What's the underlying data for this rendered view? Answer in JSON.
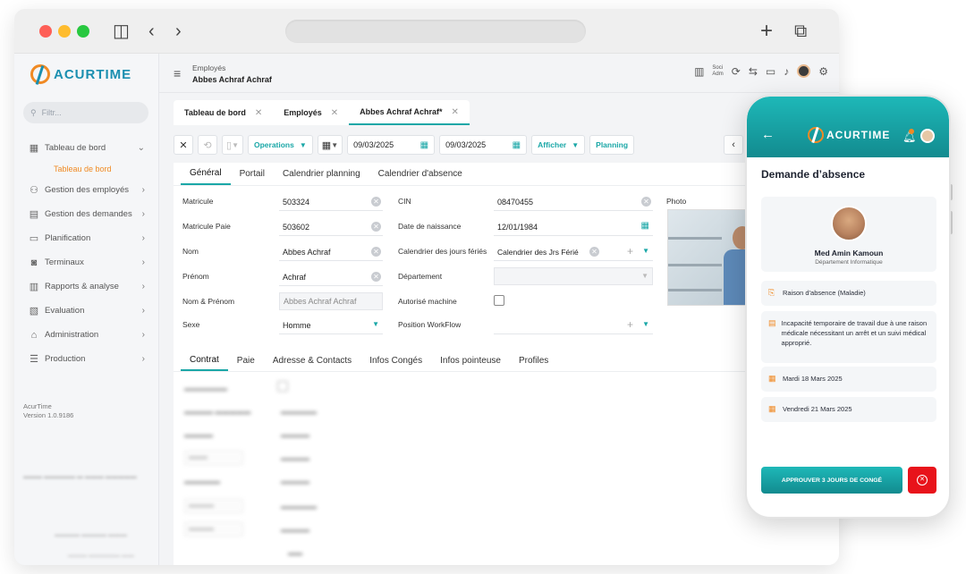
{
  "sidebar": {
    "logo_text": "ACURTIME",
    "filter_placeholder": "Filtr...",
    "items": [
      {
        "icon": "grid-icon",
        "label": "Tableau de bord"
      },
      {
        "icon": "users-icon",
        "label": "Gestion des employés"
      },
      {
        "icon": "doc-icon",
        "label": "Gestion des demandes"
      },
      {
        "icon": "calendar-icon",
        "label": "Planification"
      },
      {
        "icon": "terminal-icon",
        "label": "Terminaux"
      },
      {
        "icon": "chart-icon",
        "label": "Rapports & analyse"
      },
      {
        "icon": "eval-icon",
        "label": "Evaluation"
      },
      {
        "icon": "admin-icon",
        "label": "Administration"
      },
      {
        "icon": "list-icon",
        "label": "Production"
      }
    ],
    "sub_item": "Tableau de bord",
    "version_name": "AcurTime",
    "version_number": "Version 1.0.9186"
  },
  "header": {
    "crumb_parent": "Employés",
    "crumb_current": "Abbes Achraf Achraf",
    "soc_line1": "Soci",
    "soc_line2": "Adm"
  },
  "tabs": [
    {
      "label": "Tableau de bord"
    },
    {
      "label": "Employés"
    },
    {
      "label": "Abbes Achraf Achraf*"
    }
  ],
  "toolbar": {
    "operations": "Operations",
    "date_from": "09/03/2025",
    "date_to": "09/03/2025",
    "afficher": "Afficher",
    "planning": "Planning"
  },
  "subtabs": [
    "Général",
    "Portail",
    "Calendrier planning",
    "Calendrier d'absence"
  ],
  "form": {
    "matricule_label": "Matricule",
    "matricule": "503324",
    "matricule_paie_label": "Matricule Paie",
    "matricule_paie": "503602",
    "nom_label": "Nom",
    "nom": "Abbes Achraf",
    "prenom_label": "Prénom",
    "prenom": "Achraf",
    "nom_prenom_label": "Nom & Prénom",
    "nom_prenom": "Abbes Achraf Achraf",
    "sexe_label": "Sexe",
    "sexe": "Homme",
    "cin_label": "CIN",
    "cin": "08470455",
    "naissance_label": "Date de naissance",
    "naissance": "12/01/1984",
    "calendrier_label": "Calendrier des jours fériés",
    "calendrier": "Calendrier des Jrs Férié",
    "departement_label": "Département",
    "autorise_label": "Autorisé machine",
    "position_label": "Position WorkFlow",
    "photo_label": "Photo"
  },
  "subtabs2": [
    "Contrat",
    "Paie",
    "Adresse & Contacts",
    "Infos Congés",
    "Infos pointeuse",
    "Profiles"
  ],
  "phone": {
    "logo_text": "ACURTIME",
    "title": "Demande d’absence",
    "name": "Med Amin Kamoun",
    "department": "Département Informatique",
    "reason": "Raison d'absence (Maladie)",
    "description": "Incapacité temporaire de travail due à une raison médicale nécessitant un arrêt et un suivi médical approprié.",
    "date_start": "Mardi 18 Mars 2025",
    "date_end": "Vendredi 21 Mars 2025",
    "approve_label": "APPROUVER 3 JOURS DE CONGÉ"
  },
  "colors": {
    "accent": "#1aa7a7",
    "brand_orange": "#f08a24",
    "reject": "#e8131b"
  }
}
